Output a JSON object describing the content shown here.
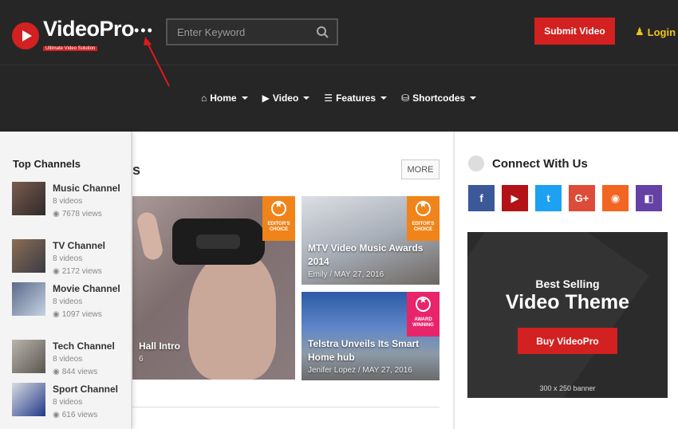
{
  "header": {
    "logo_name": "VideoPro",
    "logo_tagline": "Ultimate Video Solution",
    "search_placeholder": "Enter Keyword",
    "submit_label": "Submit Video",
    "login_label": "Login"
  },
  "nav": [
    {
      "label": "Home",
      "icon": "home-icon"
    },
    {
      "label": "Video",
      "icon": "play-circle-icon"
    },
    {
      "label": "Features",
      "icon": "list-icon"
    },
    {
      "label": "Shortcodes",
      "icon": "database-icon"
    }
  ],
  "main": {
    "section_title": "s",
    "more_label": "MORE",
    "big_card": {
      "title": "Hall Intro",
      "meta": "6"
    },
    "small_cards": [
      {
        "title": "MTV Video Music Awards 2014",
        "author": "Emily",
        "date": "MAY 27, 2016",
        "badge": "EDITOR'S CHOICE"
      },
      {
        "title": "Telstra Unveils Its Smart Home hub",
        "author": "Jenifer Lopez",
        "date": "MAY 27, 2016",
        "badge": "AWARD WINNING"
      }
    ],
    "big_badge": "EDITOR'S CHOICE"
  },
  "sidebar": {
    "title": "Top Channels",
    "channels": [
      {
        "name": "Music Channel",
        "videos": "8 videos",
        "views": "7678 views"
      },
      {
        "name": "TV Channel",
        "videos": "8 videos",
        "views": "2172 views"
      },
      {
        "name": "Movie Channel",
        "videos": "8 videos",
        "views": "1097 views"
      },
      {
        "name": "Tech Channel",
        "videos": "8 videos",
        "views": "844 views"
      },
      {
        "name": "Sport Channel",
        "videos": "8 videos",
        "views": "616 views"
      }
    ]
  },
  "right": {
    "connect_title": "Connect With Us",
    "socials": [
      {
        "name": "facebook",
        "glyph": "f",
        "color": "#3b5998"
      },
      {
        "name": "youtube",
        "glyph": "▶",
        "color": "#b31217"
      },
      {
        "name": "twitter",
        "glyph": "t",
        "color": "#1da1f2"
      },
      {
        "name": "google-plus",
        "glyph": "G+",
        "color": "#dd4b39"
      },
      {
        "name": "rss",
        "glyph": "◉",
        "color": "#f26522"
      },
      {
        "name": "twitch",
        "glyph": "◧",
        "color": "#6441a5"
      }
    ],
    "banner": {
      "subtitle": "Best Selling",
      "title": "Video Theme",
      "button": "Buy VideoPro",
      "size": "300 x 250 banner"
    }
  },
  "colors": {
    "accent": "#d32020",
    "login": "#f0c419",
    "header_bg": "#262626"
  }
}
